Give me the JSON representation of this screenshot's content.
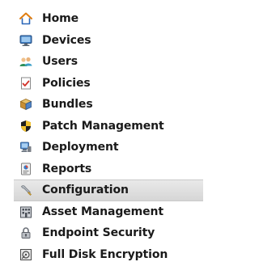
{
  "nav": {
    "selected_index": 8,
    "items": [
      {
        "label": "Home",
        "icon": "home-icon"
      },
      {
        "label": "Devices",
        "icon": "monitor-icon"
      },
      {
        "label": "Users",
        "icon": "users-icon"
      },
      {
        "label": "Policies",
        "icon": "policy-document-icon"
      },
      {
        "label": "Bundles",
        "icon": "bundle-box-icon"
      },
      {
        "label": "Patch Management",
        "icon": "shield-icon"
      },
      {
        "label": "Deployment",
        "icon": "deployment-computer-icon"
      },
      {
        "label": "Reports",
        "icon": "report-icon"
      },
      {
        "label": "Configuration",
        "icon": "wrench-icon"
      },
      {
        "label": "Asset Management",
        "icon": "building-icon"
      },
      {
        "label": "Endpoint Security",
        "icon": "lock-icon"
      },
      {
        "label": "Full Disk Encryption",
        "icon": "disk-encryption-icon"
      }
    ]
  },
  "colors": {
    "text": "#1a1a1a",
    "selected_background": "#dcdcdc",
    "selected_border": "#c9c9c9"
  }
}
